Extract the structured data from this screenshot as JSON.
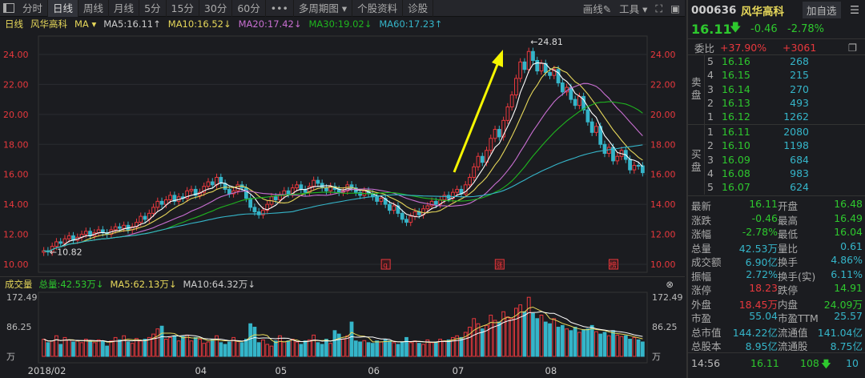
{
  "toolbar": {
    "tabs": [
      "分时",
      "日线",
      "周线",
      "月线",
      "5分",
      "15分",
      "30分",
      "60分",
      "•••",
      "多周期图 ▾",
      "个股资料",
      "诊股"
    ],
    "active": 1,
    "draw": "画线✎",
    "tools": "工具 ▾",
    "fullscreen": "⛶",
    "panel": "▣"
  },
  "chart_icons": [
    "lock-icon",
    "refresh-icon",
    "zoom-in-icon",
    "zoom-out-icon",
    "gear-icon"
  ],
  "ma_bar": {
    "period": "日线",
    "name": "风华高科",
    "ma": "MA ▾",
    "ma5": "MA5:16.11↑",
    "ma10": "MA10:16.52↓",
    "ma20": "MA20:17.42↓",
    "ma30": "MA30:19.02↓",
    "ma60": "MA60:17.23↑"
  },
  "volume_bar": {
    "title": "成交量",
    "total": "总量:42.53万↓",
    "ma5": "MA5:62.13万↓",
    "ma10": "MA10:64.32万↓",
    "close": "⊗"
  },
  "colors": {
    "up": "#e8383d",
    "down": "#35b5c9",
    "ma5": "#ffffff",
    "ma10": "#e6d75a",
    "ma20": "#c86fd1",
    "ma30": "#1fb51f",
    "ma60": "#35b5c9"
  },
  "chart_data": {
    "type": "candlestick",
    "price_ticks": [
      "10.00",
      "12.00",
      "14.00",
      "16.00",
      "18.00",
      "20.00",
      "22.00",
      "24.00"
    ],
    "price_range": [
      10,
      24
    ],
    "volume_ticks": [
      "172.49",
      "86.25",
      "万"
    ],
    "volume_max": 172.49,
    "x_labels": [
      {
        "label": "2018/02",
        "index": 0
      },
      {
        "label": "04",
        "index": 37
      },
      {
        "label": "05",
        "index": 56
      },
      {
        "label": "06",
        "index": 78
      },
      {
        "label": "07",
        "index": 98
      },
      {
        "label": "08",
        "index": 120
      }
    ],
    "high_label": "←24.81",
    "low_label": "←10.82",
    "high": 24.81,
    "low": 10.82,
    "markers": [
      {
        "text": "q",
        "index": 81
      },
      {
        "text": "涨",
        "index": 108
      },
      {
        "text": "榜",
        "index": 135
      }
    ],
    "closes": [
      10.9,
      10.82,
      11.2,
      11.5,
      11.4,
      11.7,
      11.9,
      11.6,
      11.8,
      12.0,
      12.2,
      11.9,
      12.1,
      12.3,
      12.1,
      12.0,
      12.3,
      12.5,
      12.4,
      12.6,
      12.3,
      12.5,
      12.8,
      13.2,
      13.0,
      13.4,
      13.8,
      14.2,
      14.0,
      14.3,
      14.6,
      14.2,
      14.5,
      14.4,
      14.9,
      15.0,
      14.6,
      14.8,
      15.2,
      15.5,
      15.3,
      15.8,
      15.4,
      15.0,
      14.7,
      14.9,
      15.3,
      15.1,
      14.4,
      13.8,
      13.5,
      13.3,
      13.6,
      14.0,
      14.5,
      14.3,
      14.6,
      14.9,
      14.7,
      15.1,
      15.3,
      15.0,
      14.8,
      15.2,
      15.6,
      15.4,
      15.1,
      14.9,
      15.2,
      15.0,
      14.8,
      14.9,
      15.3,
      15.1,
      14.8,
      14.6,
      14.9,
      14.7,
      14.5,
      14.2,
      14.4,
      14.0,
      13.6,
      13.9,
      13.4,
      13.0,
      12.8,
      13.2,
      13.5,
      13.3,
      13.7,
      13.9,
      14.2,
      14.0,
      14.3,
      14.6,
      14.4,
      14.8,
      15.0,
      14.7,
      15.3,
      15.8,
      16.5,
      17.2,
      16.8,
      17.6,
      18.4,
      19.0,
      18.5,
      19.6,
      20.5,
      21.3,
      22.4,
      23.5,
      23.0,
      24.2,
      23.6,
      22.9,
      23.4,
      22.8,
      22.6,
      23.0,
      22.1,
      21.5,
      21.8,
      21.0,
      20.6,
      21.2,
      20.3,
      19.5,
      18.8,
      19.2,
      18.0,
      17.4,
      17.8,
      16.9,
      17.2,
      17.6,
      17.0,
      16.3,
      16.6,
      16.57,
      16.11
    ],
    "volumes": [
      50,
      40,
      45,
      60,
      35,
      55,
      48,
      42,
      45,
      40,
      50,
      45,
      40,
      48,
      45,
      30,
      45,
      55,
      48,
      60,
      42,
      38,
      52,
      45,
      50,
      55,
      65,
      80,
      88,
      50,
      55,
      60,
      45,
      58,
      62,
      45,
      55,
      50,
      38,
      42,
      50,
      60,
      40,
      35,
      42,
      55,
      45,
      40,
      50,
      95,
      85,
      40,
      48,
      35,
      30,
      45,
      60,
      42,
      45,
      50,
      42,
      35,
      45,
      48,
      62,
      40,
      35,
      50,
      38,
      75,
      65,
      50,
      60,
      100,
      45,
      42,
      46,
      40,
      38,
      45,
      42,
      50,
      45,
      40,
      35,
      42,
      55,
      40,
      45,
      38,
      35,
      48,
      40,
      42,
      50,
      45,
      48,
      55,
      60,
      55,
      70,
      85,
      110,
      95,
      80,
      90,
      120,
      105,
      100,
      130,
      115,
      110,
      140,
      150,
      130,
      172,
      125,
      110,
      120,
      100,
      95,
      110,
      85,
      90,
      80,
      75,
      85,
      70,
      78,
      80,
      90,
      72,
      65,
      70,
      60,
      75,
      62,
      58,
      60,
      50,
      55,
      48,
      42
    ]
  },
  "quote": {
    "code": "000636",
    "name": "风华高科",
    "add": "加自选",
    "menu": "☰",
    "price": "16.11",
    "arrow": "🡇",
    "change": "-0.46",
    "pct": "-2.78%",
    "weibi_label": "委比",
    "weibi": "+37.90%",
    "weicha": "+3061",
    "sell_label": "卖盘",
    "buy_label": "买盘",
    "asks": [
      {
        "lv": "5",
        "p": "16.16",
        "v": "268"
      },
      {
        "lv": "4",
        "p": "16.15",
        "v": "215"
      },
      {
        "lv": "3",
        "p": "16.14",
        "v": "270"
      },
      {
        "lv": "2",
        "p": "16.13",
        "v": "493"
      },
      {
        "lv": "1",
        "p": "16.12",
        "v": "1262"
      }
    ],
    "bids": [
      {
        "lv": "1",
        "p": "16.11",
        "v": "2080"
      },
      {
        "lv": "2",
        "p": "16.10",
        "v": "1198"
      },
      {
        "lv": "3",
        "p": "16.09",
        "v": "684"
      },
      {
        "lv": "4",
        "p": "16.08",
        "v": "983"
      },
      {
        "lv": "5",
        "p": "16.07",
        "v": "624"
      }
    ],
    "stats": [
      [
        "最新",
        "16.11",
        "g",
        "开盘",
        "16.48",
        "g"
      ],
      [
        "涨跌",
        "-0.46",
        "g",
        "最高",
        "16.49",
        "g"
      ],
      [
        "涨幅",
        "-2.78%",
        "g",
        "最低",
        "16.04",
        "g"
      ],
      [
        "总量",
        "42.53万",
        "c",
        "量比",
        "0.61",
        "c"
      ],
      [
        "成交额",
        "6.90亿",
        "c",
        "换手",
        "4.86%",
        "c"
      ],
      [
        "振幅",
        "2.72%",
        "c",
        "换手(实)",
        "6.11%",
        "c"
      ],
      [
        "涨停",
        "18.23",
        "r",
        "跌停",
        "14.91",
        "g"
      ],
      [
        "外盘",
        "18.45万",
        "r",
        "内盘",
        "24.09万",
        "g"
      ],
      [
        "市盈",
        "55.04",
        "c",
        "市盈TTM",
        "25.57",
        "c"
      ],
      [
        "总市值",
        "144.22亿",
        "c",
        "流通值",
        "141.04亿",
        "c"
      ],
      [
        "总股本",
        "8.95亿",
        "c",
        "流通股",
        "8.75亿",
        "c"
      ]
    ],
    "ticks": [
      {
        "time": "14:56",
        "price": "16.11",
        "vol": "108",
        "dir": "🡇",
        "n": "10"
      }
    ]
  }
}
